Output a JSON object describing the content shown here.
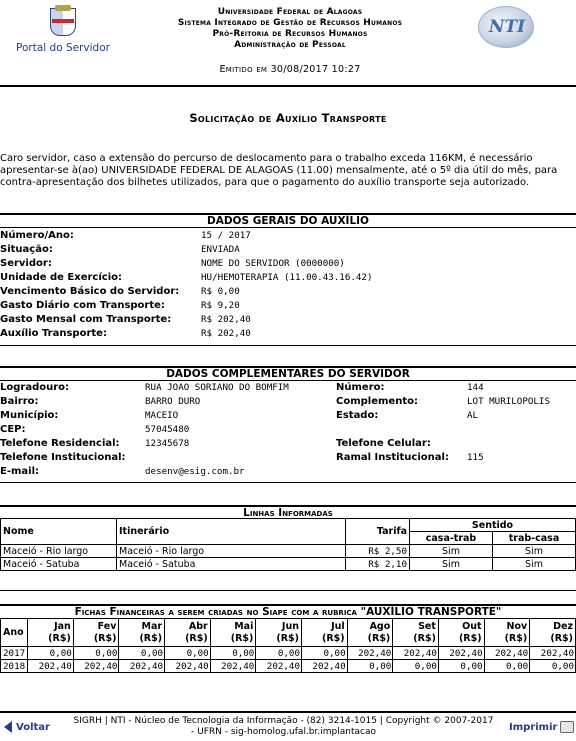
{
  "header": {
    "portal_label": "Portal do Servidor",
    "institution_lines": [
      "Universidade Federal de Alagoas",
      "Sistema Integrado de Gestão de Recursos Humanos",
      "Pró-Reitoria de Recursos Humanos",
      "Administração de Pessoal"
    ],
    "emitido": "Emitido em 30/08/2017 10:27",
    "nti_logo": "NTI"
  },
  "title": "Solicitação de Auxílio Transporte",
  "intro": "Caro servidor, caso a extensão do percurso de deslocamento para o trabalho exceda 116KM, é necessário apresentar-se à(ao) UNIVERSIDADE FEDERAL DE ALAGOAS (11.00) mensalmente, até o 5º dia útil do mês, para contra-apresentação dos bilhetes utilizados, para que o pagamento do auxílio transporte seja autorizado.",
  "dados_gerais": {
    "title": "DADOS GERAIS DO AUXÍLIO",
    "rows": [
      {
        "label": "Número/Ano:",
        "value": "15 / 2017"
      },
      {
        "label": "Situação:",
        "value": "ENVIADA"
      },
      {
        "label": "Servidor:",
        "value": "NOME DO SERVIDOR (0000000)"
      },
      {
        "label": "Unidade de Exercício:",
        "value": "HU/HEMOTERAPIA (11.00.43.16.42)"
      },
      {
        "label": "Vencimento Básico do Servidor:",
        "value": "R$ 0,00"
      },
      {
        "label": "Gasto Diário com Transporte:",
        "value": "R$ 9,20"
      },
      {
        "label": "Gasto Mensal com Transporte:",
        "value": "R$ 202,40"
      },
      {
        "label": "Auxílio Transporte:",
        "value": "R$ 202,40"
      }
    ]
  },
  "dados_complementares": {
    "title": "DADOS COMPLEMENTARES DO SERVIDOR",
    "left": [
      {
        "label": "Logradouro:",
        "value": "RUA JOAO SORIANO DO BOMFIM"
      },
      {
        "label": "Bairro:",
        "value": "BARRO DURO"
      },
      {
        "label": "Município:",
        "value": "MACEIO"
      },
      {
        "label": "CEP:",
        "value": "57045480"
      },
      {
        "label": "Telefone Residencial:",
        "value": "12345678"
      },
      {
        "label": "Telefone Institucional:",
        "value": ""
      },
      {
        "label": "E-mail:",
        "value": "desenv@esig.com.br"
      }
    ],
    "right": [
      {
        "label": "Número:",
        "value": "144"
      },
      {
        "label": "Complemento:",
        "value": "LOT MURILOPOLIS"
      },
      {
        "label": "Estado:",
        "value": "AL"
      },
      {
        "label": "",
        "value": ""
      },
      {
        "label": "Telefone Celular:",
        "value": ""
      },
      {
        "label": "Ramal Institucional:",
        "value": "115"
      }
    ]
  },
  "linhas": {
    "title": "Linhas Informadas",
    "headers": {
      "nome": "Nome",
      "itinerario": "Itinerário",
      "tarifa": "Tarifa",
      "sentido": "Sentido",
      "casa_trab": "casa-trab",
      "trab_casa": "trab-casa"
    },
    "rows": [
      {
        "nome": "Maceió - Rio largo",
        "itinerario": "Maceió - Rio largo",
        "tarifa": "R$ 2,50",
        "casa_trab": "Sim",
        "trab_casa": "Sim"
      },
      {
        "nome": "Maceió - Satuba",
        "itinerario": "Maceió - Satuba",
        "tarifa": "R$ 2,10",
        "casa_trab": "Sim",
        "trab_casa": "Sim"
      }
    ]
  },
  "fichas": {
    "title": "Fichas Financeiras a serem criadas no Siape com a rubrica \"AUXÍLIO TRANSPORTE\"",
    "ano_label": "Ano",
    "months": [
      "Jan",
      "Fev",
      "Mar",
      "Abr",
      "Mai",
      "Jun",
      "Jul",
      "Ago",
      "Set",
      "Out",
      "Nov",
      "Dez"
    ],
    "currency": "(R$)",
    "rows": [
      {
        "ano": "2017",
        "values": [
          "0,00",
          "0,00",
          "0,00",
          "0,00",
          "0,00",
          "0,00",
          "0,00",
          "202,40",
          "202,40",
          "202,40",
          "202,40",
          "202,40"
        ]
      },
      {
        "ano": "2018",
        "values": [
          "202,40",
          "202,40",
          "202,40",
          "202,40",
          "202,40",
          "202,40",
          "202,40",
          "0,00",
          "0,00",
          "0,00",
          "0,00",
          "0,00"
        ]
      }
    ]
  },
  "footer": {
    "voltar": "Voltar",
    "line1": "SIGRH | NTI - Núcleo de Tecnologia da Informação - (82) 3214-1015 | Copyright © 2007-2017",
    "line2": "- UFRN - sig-homolog.ufal.br.implantacao",
    "imprimir": "Imprimir"
  }
}
